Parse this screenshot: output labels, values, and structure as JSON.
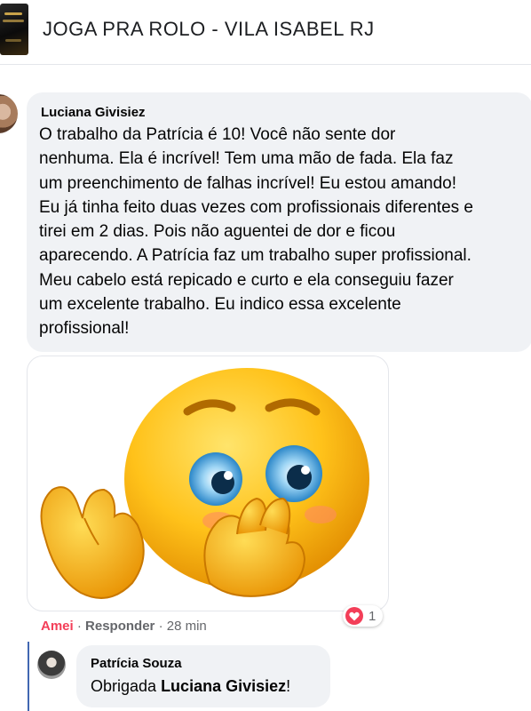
{
  "group": {
    "title": "JOGA PRA ROLO - VILA ISABEL RJ"
  },
  "comment": {
    "author": "Luciana Givisiez",
    "lines": [
      "O trabalho da Patrícia é 10! Você não sente dor",
      "nenhuma. Ela é incrível! Tem uma mão de fada. Ela faz",
      "um preenchimento de falhas incrível! Eu estou amando!",
      "Eu já tinha feito duas vezes com profissionais diferentes e",
      "tirei em 2 dias. Pois não aguentei de dor e ficou",
      "aparecendo. A Patrícia faz um trabalho super profissional.",
      "Meu cabelo está repicado e curto e ela conseguiu fazer",
      "um excelente trabalho. Eu indico essa excelente",
      "profissional!"
    ],
    "sticker_icon": "shy-smiley-emoji-sticker",
    "actions": {
      "love_label": "Amei",
      "separator": "·",
      "reply_label": "Responder",
      "time": "28 min"
    },
    "reaction": {
      "icon": "heart-icon",
      "count": "1"
    }
  },
  "reply": {
    "author": "Patrícia Souza",
    "text_prefix": "Obrigada ",
    "mention": "Luciana Givisiez",
    "text_suffix": "!"
  },
  "colors": {
    "bubble_bg": "#f0f2f5",
    "love": "#f33e58",
    "muted": "#65676b",
    "thread_line": "#4267b2"
  }
}
